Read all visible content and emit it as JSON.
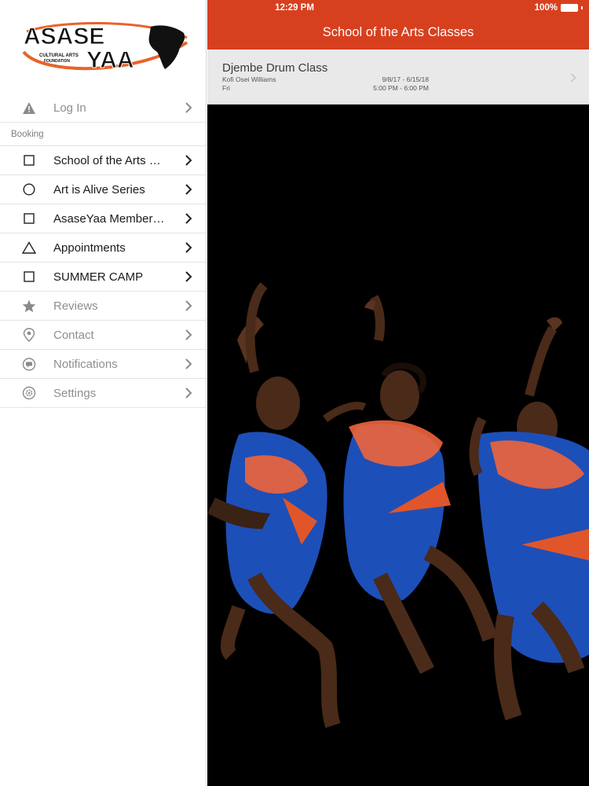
{
  "status_bar": {
    "time": "12:29 PM",
    "battery": "100%"
  },
  "logo": {
    "line1": "ASASE",
    "line2": "YAA",
    "tagline1": "CULTURAL ARTS",
    "tagline2": "FOUNDATION"
  },
  "sidebar": {
    "login": {
      "label": "Log In",
      "icon": "warning-icon"
    },
    "section_booking": "Booking",
    "items": [
      {
        "label": "School of the Arts Classes",
        "icon": "square-icon"
      },
      {
        "label": "Art is Alive Series",
        "icon": "circle-icon"
      },
      {
        "label": "AsaseYaa Membership",
        "icon": "square-icon"
      },
      {
        "label": "Appointments",
        "icon": "triangle-icon"
      },
      {
        "label": "SUMMER CAMP",
        "icon": "square-icon"
      }
    ],
    "secondary": [
      {
        "label": "Reviews",
        "icon": "star-icon"
      },
      {
        "label": "Contact",
        "icon": "location-pin-icon"
      },
      {
        "label": "Notifications",
        "icon": "chat-bubble-icon"
      },
      {
        "label": "Settings",
        "icon": "gear-icon"
      }
    ]
  },
  "header": {
    "title": "School of the Arts Classes"
  },
  "class_item": {
    "title": "Djembe Drum Class",
    "instructor": "Kofi Osei Williams",
    "day": "Fri",
    "dates": "9/8/17 - 6/15/18",
    "times": "5:00 PM - 6:00 PM"
  },
  "colors": {
    "accent": "#d7401f",
    "row_bg": "#e9e9e9",
    "photo_bg": "#000000"
  }
}
